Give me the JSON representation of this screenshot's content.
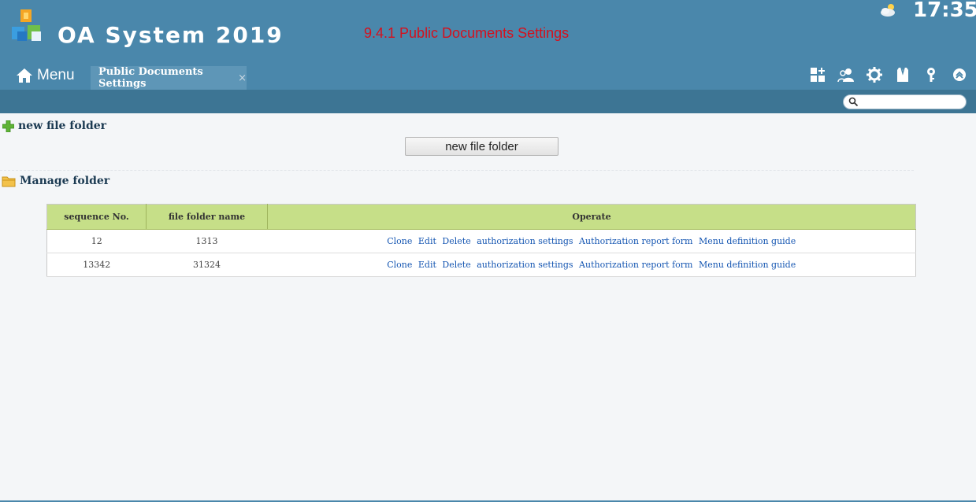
{
  "header": {
    "app_title": "OA System 2019",
    "page_heading": "9.4.1 Public Documents Settings",
    "clock": "17:35",
    "menu_label": "Menu",
    "active_tab": "Public Documents Settings",
    "tab_close": "×",
    "search": {
      "placeholder": ""
    },
    "toolbar_icons": [
      "grid-add-icon",
      "user-group-icon",
      "gear-icon",
      "shirt-icon",
      "key-icon",
      "chevron-up-icon"
    ]
  },
  "sections": {
    "new_folder_title": "new file folder",
    "new_folder_button": "new file folder",
    "manage_title": "Manage folder"
  },
  "table": {
    "columns": [
      "sequence No.",
      "file folder name",
      "Operate"
    ],
    "rows": [
      {
        "sequence": "12",
        "name": "1313"
      },
      {
        "sequence": "13342",
        "name": "31324"
      }
    ],
    "operations": [
      "Clone",
      "Edit",
      "Delete",
      "authorization settings",
      "Authorization report form",
      "Menu definition guide"
    ]
  },
  "colors": {
    "header_bg": "#4a87ab",
    "subbar_bg": "#3d7594",
    "table_header_bg": "#c6df88",
    "link": "#1556b2",
    "heading_red": "#d4111e"
  }
}
